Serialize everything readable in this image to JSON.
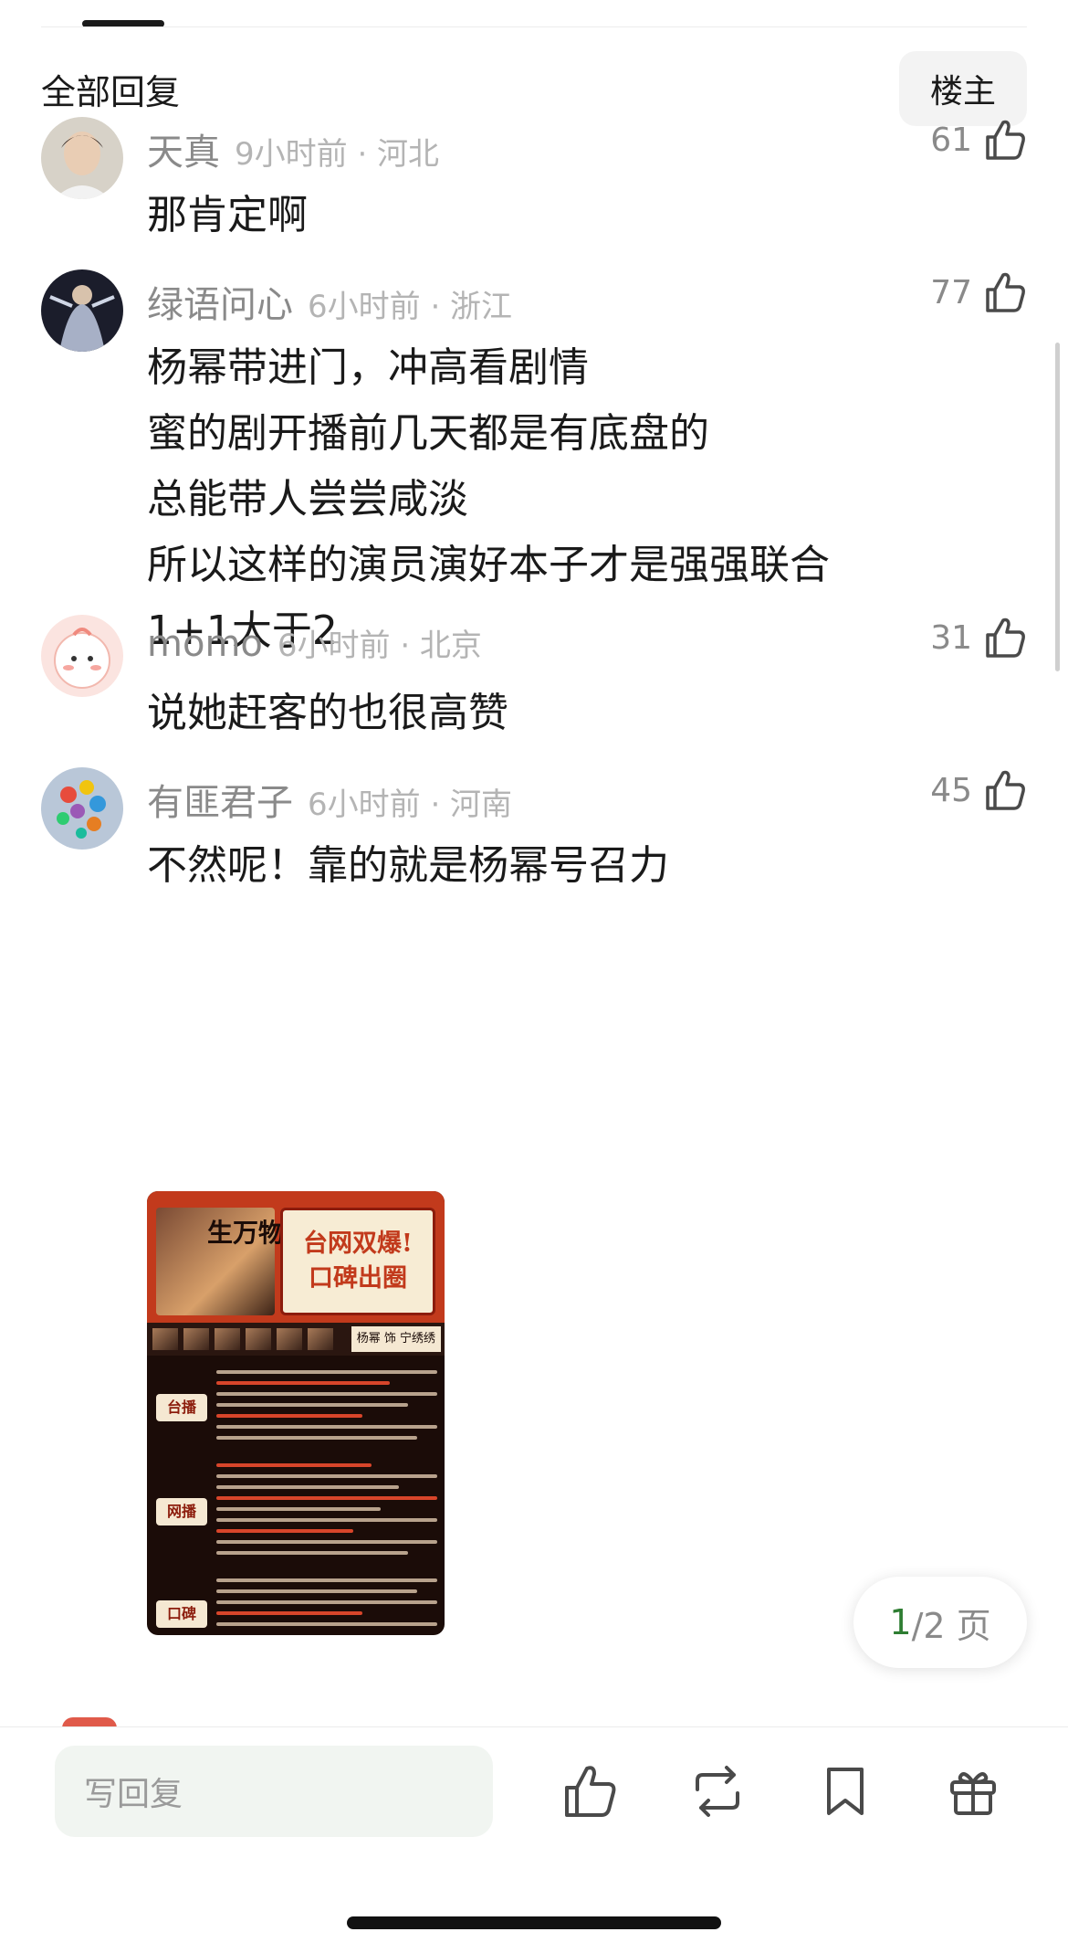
{
  "header": {
    "title": "全部回复",
    "op_button": "楼主"
  },
  "comments": [
    {
      "username": "天真",
      "meta": "9小时前 · 河北",
      "likes": "61",
      "lines": [
        "那肯定啊"
      ]
    },
    {
      "username": "绿语问心",
      "meta": "6小时前 · 浙江",
      "likes": "77",
      "lines": [
        "杨幂带进门，冲高看剧情",
        "蜜的剧开播前几天都是有底盘的",
        "总能带人尝尝咸淡",
        "所以这样的演员演好本子才是强强联合",
        "1+1大于2"
      ]
    },
    {
      "username": "momo",
      "meta": "6小时前 · 北京",
      "likes": "31",
      "lines": [
        "说她赶客的也很高赞"
      ]
    },
    {
      "username": "有匪君子",
      "meta": "6小时前 · 河南",
      "likes": "45",
      "lines": [
        "不然呢！靠的就是杨幂号召力"
      ],
      "image": {
        "brush_title": "生万物",
        "slogan_line1": "台网双爆!",
        "slogan_line2": "口碑出圈",
        "cast_label": "杨幂 饰 宁绣绣",
        "sections": [
          "台播",
          "网播",
          "口碑"
        ]
      }
    }
  ],
  "pager": {
    "current": "1",
    "total_suffix": "/2 页"
  },
  "bottom_bar": {
    "reply_placeholder": "写回复"
  },
  "icons": {
    "like": "thumbs-up-icon",
    "repost": "repost-icon",
    "favorite": "bookmark-icon",
    "gift": "gift-icon"
  },
  "colors": {
    "accent_green": "#2e7d32",
    "meta_gray": "#b4b4b4",
    "username_gray": "#8a8a8a"
  }
}
